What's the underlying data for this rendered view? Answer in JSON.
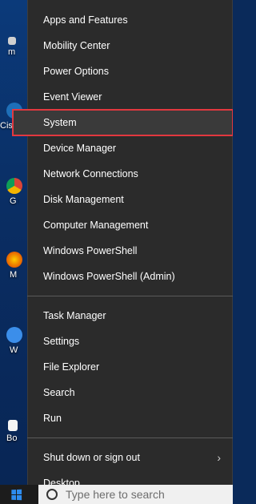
{
  "desktop": {
    "icons": [
      {
        "name": "recycle",
        "label": "m",
        "color": "#d0d0d0"
      },
      {
        "name": "cisco",
        "label": "Cisc",
        "color": "#1e6fb8"
      },
      {
        "name": "chrome",
        "label": "G C",
        "color": "#2aa44f"
      },
      {
        "name": "firefox",
        "label": "M F",
        "color": "#e66000"
      },
      {
        "name": "edge",
        "label": "W Pro",
        "color": "#3b8eea"
      },
      {
        "name": "box",
        "label": "Bo",
        "color": "#f5f5f5"
      }
    ]
  },
  "menu": {
    "groups": [
      {
        "items": [
          {
            "label": "Apps and Features"
          },
          {
            "label": "Mobility Center"
          },
          {
            "label": "Power Options"
          },
          {
            "label": "Event Viewer"
          },
          {
            "label": "System",
            "highlighted": true
          },
          {
            "label": "Device Manager"
          },
          {
            "label": "Network Connections"
          },
          {
            "label": "Disk Management"
          },
          {
            "label": "Computer Management"
          },
          {
            "label": "Windows PowerShell"
          },
          {
            "label": "Windows PowerShell (Admin)"
          }
        ]
      },
      {
        "items": [
          {
            "label": "Task Manager"
          },
          {
            "label": "Settings"
          },
          {
            "label": "File Explorer"
          },
          {
            "label": "Search"
          },
          {
            "label": "Run"
          }
        ]
      },
      {
        "items": [
          {
            "label": "Shut down or sign out",
            "submenu": true,
            "chevron": "›"
          },
          {
            "label": "Desktop"
          }
        ]
      }
    ]
  },
  "taskbar": {
    "search_placeholder": "Type here to search"
  },
  "colors": {
    "menu_bg": "#2b2b2b",
    "highlight_outline": "#e2383f",
    "accent": "#2d8cf0"
  }
}
